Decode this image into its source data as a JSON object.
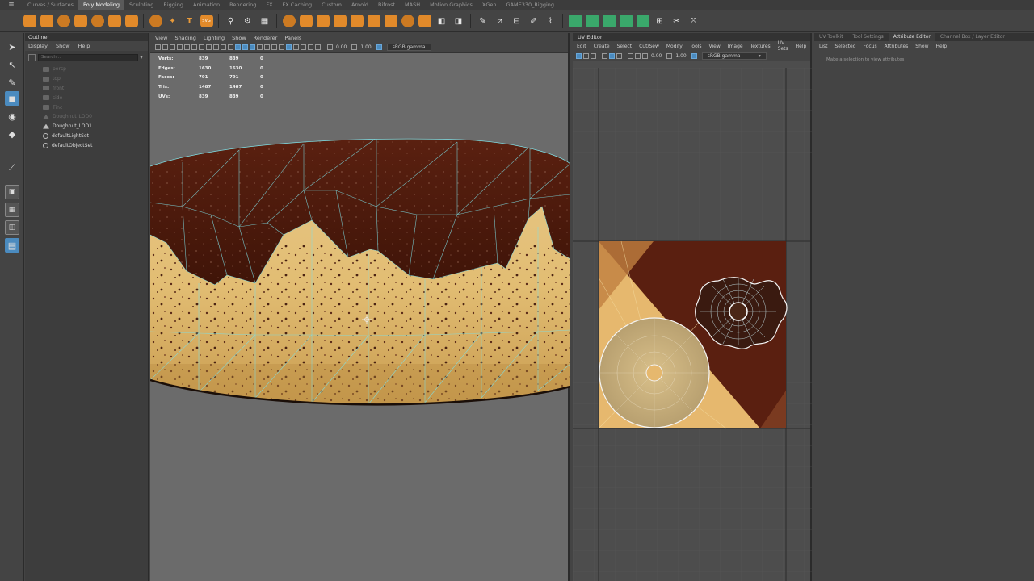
{
  "shelf_tabs": [
    "Curves / Surfaces",
    "Poly Modeling",
    "Sculpting",
    "Rigging",
    "Animation",
    "Rendering",
    "FX",
    "FX Caching",
    "Custom",
    "Arnold",
    "Bifrost",
    "MASH",
    "Motion Graphics",
    "XGen",
    "GAME330_Rigging"
  ],
  "shelf_active_tab": "Poly Modeling",
  "outliner": {
    "title": "Outliner",
    "menu": [
      "Display",
      "Show",
      "Help"
    ],
    "search_placeholder": "Search...",
    "items": [
      {
        "label": "persp",
        "state": "dim",
        "icon": "camera-icon"
      },
      {
        "label": "top",
        "state": "dim",
        "icon": "camera-icon"
      },
      {
        "label": "front",
        "state": "dim",
        "icon": "camera-icon"
      },
      {
        "label": "side",
        "state": "dim",
        "icon": "camera-icon"
      },
      {
        "label": "Tinc",
        "state": "dim",
        "icon": "camera-icon"
      },
      {
        "label": "Doughnut_LOD0",
        "state": "dim",
        "icon": "mesh-icon"
      },
      {
        "label": "Doughnut_LOD1",
        "state": "bright",
        "icon": "mesh-icon"
      },
      {
        "label": "defaultLightSet",
        "state": "bright",
        "icon": "set-icon"
      },
      {
        "label": "defaultObjectSet",
        "state": "bright",
        "icon": "set-icon"
      }
    ]
  },
  "viewport": {
    "menu": [
      "View",
      "Shading",
      "Lighting",
      "Show",
      "Renderer",
      "Panels"
    ],
    "exposure": "0.00",
    "gamma": "1.00",
    "color_space": "sRGB gamma",
    "hud": [
      {
        "label": "Verts:",
        "a": "839",
        "b": "839",
        "c": "0"
      },
      {
        "label": "Edges:",
        "a": "1630",
        "b": "1630",
        "c": "0"
      },
      {
        "label": "Faces:",
        "a": "791",
        "b": "791",
        "c": "0"
      },
      {
        "label": "Tris:",
        "a": "1487",
        "b": "1487",
        "c": "0"
      },
      {
        "label": "UVs:",
        "a": "839",
        "b": "839",
        "c": "0"
      }
    ]
  },
  "uv_editor": {
    "title": "UV Editor",
    "menu": [
      "Edit",
      "Create",
      "Select",
      "Cut/Sew",
      "Modify",
      "Tools",
      "View",
      "Image",
      "Textures",
      "UV Sets",
      "Help"
    ],
    "exposure": "0.00",
    "gamma": "1.00",
    "color_space": "sRGB gamma"
  },
  "attribute_editor": {
    "tabs": [
      "UV Toolkit",
      "Tool Settings",
      "Attribute Editor",
      "Channel Box / Layer Editor"
    ],
    "active_tab": "Attribute Editor",
    "menu": [
      "List",
      "Selected",
      "Focus",
      "Attributes",
      "Show",
      "Help"
    ],
    "message": "Make a selection to view attributes"
  }
}
